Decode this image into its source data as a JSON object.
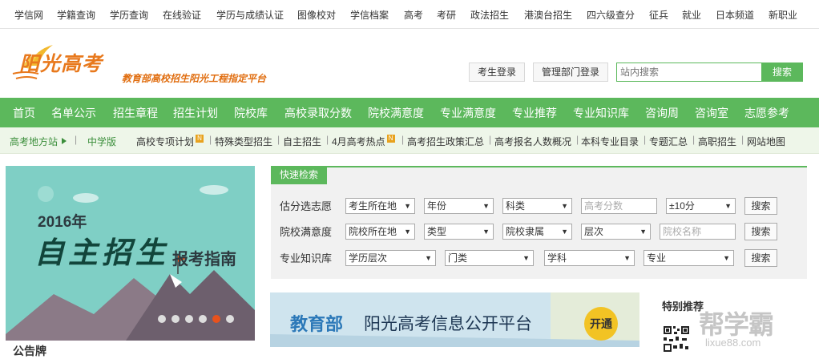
{
  "topbar": {
    "links": [
      "学信网",
      "学籍查询",
      "学历查询",
      "在线验证",
      "学历与成绩认证",
      "图像校对",
      "学信档案",
      "高考",
      "考研",
      "政法招生",
      "港澳台招生",
      "四六级查分",
      "征兵",
      "就业",
      "日本频道",
      "新职业"
    ]
  },
  "header": {
    "logo_text": "阳光高考",
    "slogan": "教育部高校招生阳光工程指定平台",
    "student_login": "考生登录",
    "admin_login": "管理部门登录",
    "search_placeholder": "站内搜索",
    "search_button": "搜索"
  },
  "nav": {
    "items": [
      "首页",
      "名单公示",
      "招生章程",
      "招生计划",
      "院校库",
      "高校录取分数",
      "院校满意度",
      "专业满意度",
      "专业推荐",
      "专业知识库",
      "咨询周",
      "咨询室",
      "志愿参考"
    ]
  },
  "subnav": {
    "location": "高考地方站",
    "middle_school": "中学版",
    "links": [
      "高校专项计划",
      "特殊类型招生",
      "自主招生",
      "4月高考热点",
      "高考招生政策汇总",
      "高考报名人数概况",
      "本科专业目录",
      "专题汇总",
      "高职招生",
      "网站地图"
    ]
  },
  "banner": {
    "year": "2016年",
    "title": "自主招生",
    "subtitle": "报考指南",
    "slide_count": 6,
    "active_slide": 5
  },
  "below_banner": {
    "title": "公告牌"
  },
  "quick_search": {
    "tab": "快速检索",
    "row1": {
      "label": "估分选志愿",
      "selects": [
        "考生所在地",
        "年份",
        "科类"
      ],
      "input_placeholder": "高考分数",
      "range_select": "±10分",
      "button": "搜索"
    },
    "row2": {
      "label": "院校满意度",
      "selects": [
        "院校所在地",
        "类型",
        "院校隶属",
        "层次"
      ],
      "input_placeholder": "院校名称",
      "button": "搜索"
    },
    "row3": {
      "label": "专业知识库",
      "selects": [
        "学历层次",
        "门类",
        "学科",
        "专业"
      ],
      "button": "搜索"
    }
  },
  "ad": {
    "part1": "教育部",
    "part2": "阳光高考信息公开平台",
    "button": "开通"
  },
  "sidebar": {
    "title": "特别推荐"
  },
  "watermark": {
    "text": "帮学霸",
    "subtext": "lixue88.com"
  },
  "colors": {
    "brand_green": "#5cb85c",
    "logo_orange": "#e8791d",
    "banner_teal": "#7fcfc5"
  }
}
